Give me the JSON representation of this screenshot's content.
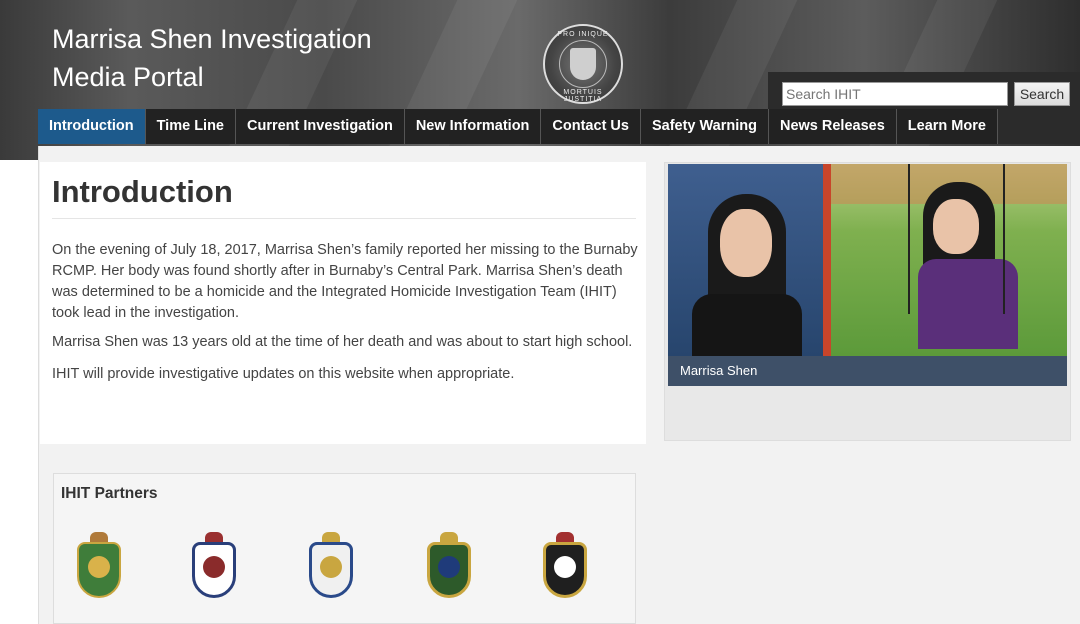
{
  "header": {
    "title_line1": "Marrisa Shen Investigation",
    "title_line2": "Media Portal",
    "seal_text_top": "PRO INIQUE",
    "seal_text_bottom": "MORTUIS JUSTITIA"
  },
  "search": {
    "placeholder": "Search IHIT",
    "button_label": "Search"
  },
  "nav": {
    "items": [
      {
        "label": "Introduction",
        "active": true
      },
      {
        "label": "Time Line"
      },
      {
        "label": "Current Investigation"
      },
      {
        "label": "New Information"
      },
      {
        "label": "Contact Us"
      },
      {
        "label": "Safety Warning"
      },
      {
        "label": "News Releases"
      },
      {
        "label": "Learn More"
      }
    ]
  },
  "main": {
    "title": "Introduction",
    "paragraphs": [
      "On the evening of July 18, 2017, Marrisa Shen’s family reported her missing to the Burnaby RCMP. Her body was found shortly after in Burnaby’s Central Park. Marrisa Shen’s death was determined to be a homicide and the Integrated Homicide Investigation Team (IHIT) took lead in the investigation.",
      "Marrisa Shen was 13 years old at the time of her death and was about to start high school.",
      "IHIT will provide investigative updates on this website when appropriate."
    ]
  },
  "photo": {
    "caption": "Marrisa Shen"
  },
  "partners": {
    "title": "IHIT Partners"
  },
  "colors": {
    "nav_active": "#1d5a8c",
    "nav_bg": "#222222",
    "caption_bar": "#3e5068"
  }
}
